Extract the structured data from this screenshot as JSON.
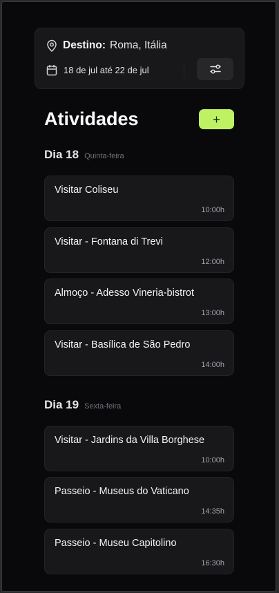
{
  "header": {
    "destination_label": "Destino:",
    "destination_value": "Roma, Itália",
    "date_range": "18 de jul até 22 de jul",
    "icons": {
      "location": "map-pin-icon",
      "calendar": "calendar-icon",
      "settings": "sliders-icon"
    }
  },
  "title": "Atividades",
  "add_button_label": "+",
  "accent_color": "#bef264",
  "days": [
    {
      "title": "Dia 18",
      "weekday": "Quinta-feira",
      "activities": [
        {
          "name": "Visitar Coliseu",
          "time": "10:00h"
        },
        {
          "name": "Visitar - Fontana di Trevi",
          "time": "12:00h"
        },
        {
          "name": "Almoço - Adesso Vineria-bistrot",
          "time": "13:00h"
        },
        {
          "name": "Visitar - Basílica de São Pedro",
          "time": "14:00h"
        }
      ]
    },
    {
      "title": "Dia 19",
      "weekday": "Sexta-feira",
      "activities": [
        {
          "name": "Visitar - Jardins da Villa Borghese",
          "time": "10:00h"
        },
        {
          "name": "Passeio - Museus do Vaticano",
          "time": "14:35h"
        },
        {
          "name": "Passeio - Museu Capitolino",
          "time": "16:30h"
        }
      ]
    }
  ]
}
